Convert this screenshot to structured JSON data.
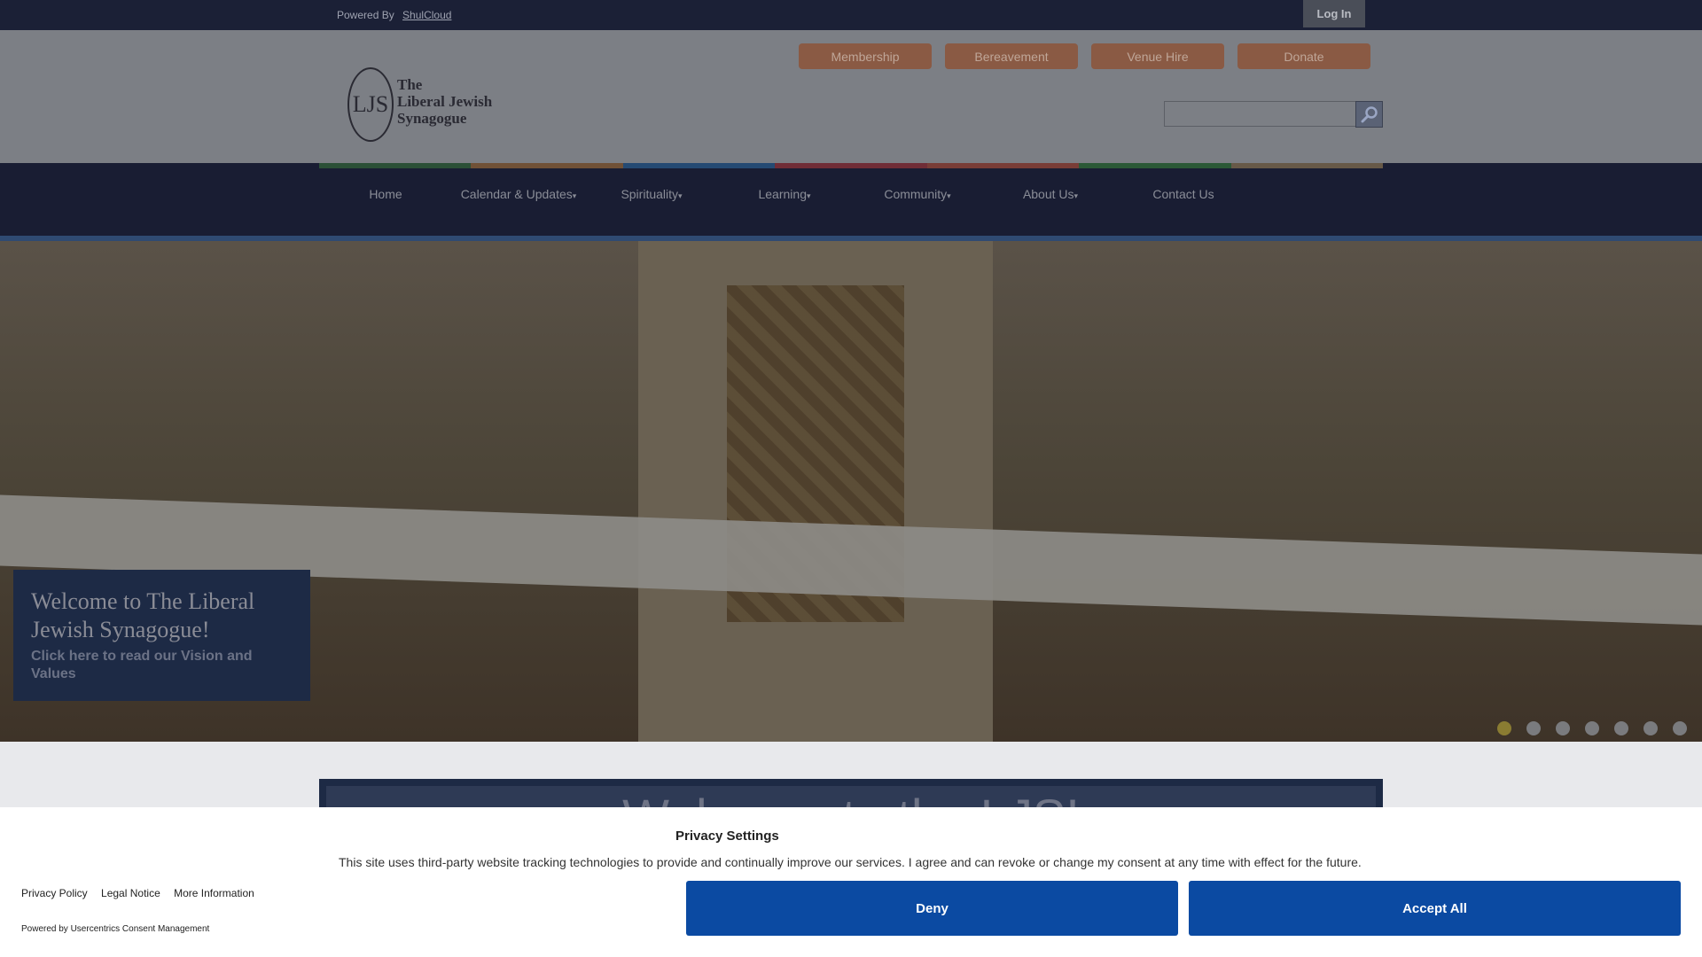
{
  "topbar": {
    "powered_prefix": "Powered By",
    "powered_link": "ShulCloud",
    "login_label": "Log In"
  },
  "header": {
    "pills": [
      "Membership",
      "Bereavement",
      "Venue Hire",
      "Donate"
    ],
    "logo_monogram": "LJS",
    "logo_lines": [
      "The",
      "Liberal Jewish",
      "Synagogue"
    ],
    "search_placeholder": ""
  },
  "nav": {
    "colorbars": [
      "#3b7a3b",
      "#b87b3a",
      "#2f6fa8",
      "#b83b3b",
      "#c9583a",
      "#3b8a3b",
      "#a88a5a"
    ],
    "items": [
      {
        "label": "Home",
        "caret": ""
      },
      {
        "label": "Calendar & Updates",
        "caret": "▾"
      },
      {
        "label": "Spirituality",
        "caret": "▾"
      },
      {
        "label": "Learning",
        "caret": "▾"
      },
      {
        "label": "Community",
        "caret": "▾"
      },
      {
        "label": "About Us",
        "caret": "▾"
      },
      {
        "label": "Contact Us",
        "caret": ""
      }
    ]
  },
  "hero": {
    "caption_title": "Welcome to The Liberal Jewish Synagogue!",
    "caption_link": "Click here to read our Vision and Values",
    "slides": 7,
    "active_slide": 1
  },
  "welcome": {
    "text": "Welcome to the LJS!"
  },
  "consent": {
    "title": "Privacy Settings",
    "text": "This site uses third-party website tracking technologies to provide and continually improve our services. I agree and can revoke or change my consent at any time with effect for the future.",
    "links": [
      "Privacy Policy",
      "Legal Notice",
      "More Information"
    ],
    "powered": "Powered by Usercentrics Consent Management",
    "deny_label": "Deny",
    "accept_label": "Accept All"
  }
}
